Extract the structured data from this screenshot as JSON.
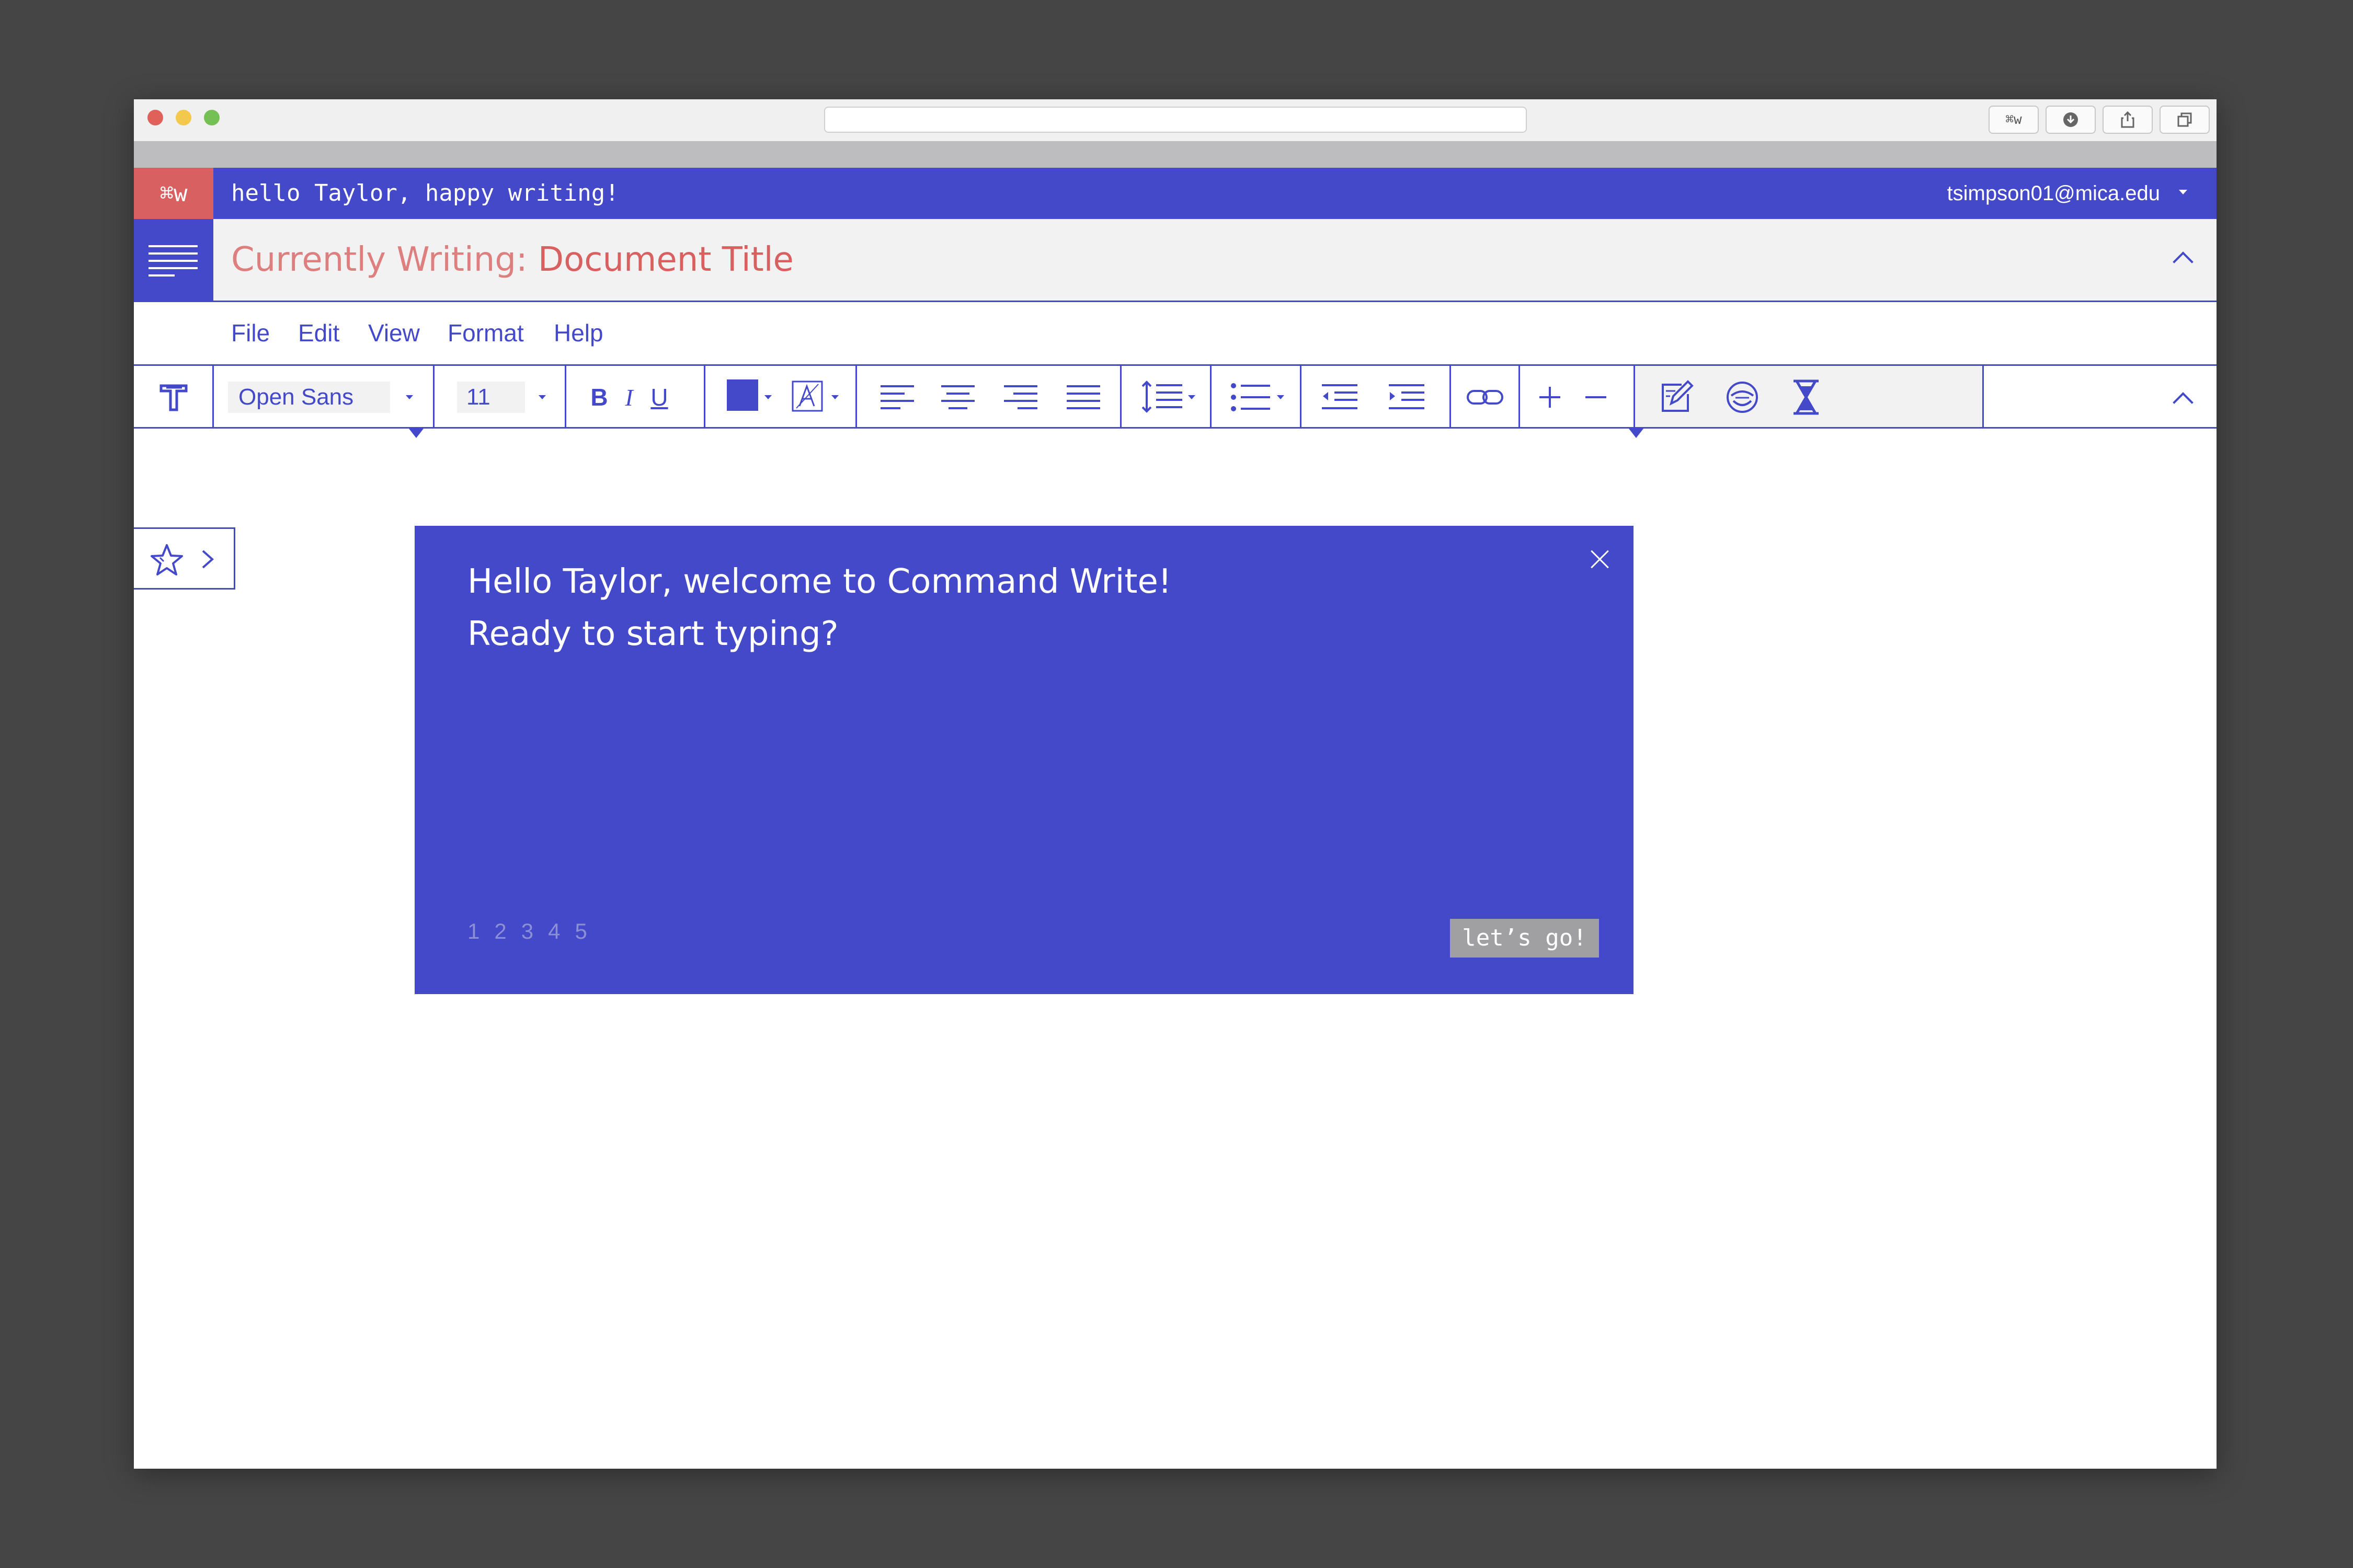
{
  "app": {
    "logo_label": "⌘w",
    "greeting": "hello Taylor, happy writing!",
    "user_email": "tsimpson01@mica.edu"
  },
  "browser": {
    "toolbar_buttons": [
      "⌘w"
    ]
  },
  "document": {
    "label": "Currently Writing:",
    "title": "Document Title"
  },
  "menu": {
    "items": [
      "File",
      "Edit",
      "View",
      "Format",
      "Help"
    ]
  },
  "toolbar": {
    "font_family": "Open Sans",
    "font_size": "11",
    "bold": "B",
    "italic": "I",
    "underline": "U",
    "text_color": "#4349c8"
  },
  "welcome": {
    "line1": "Hello Taylor, welcome to Command Write!",
    "line2": "Ready to start typing?",
    "pages": [
      "1",
      "2",
      "3",
      "4",
      "5"
    ],
    "cta": "let’s go!"
  },
  "colors": {
    "brand_blue": "#4349c8",
    "accent_red": "#d96060",
    "window_bg": "#454546"
  }
}
